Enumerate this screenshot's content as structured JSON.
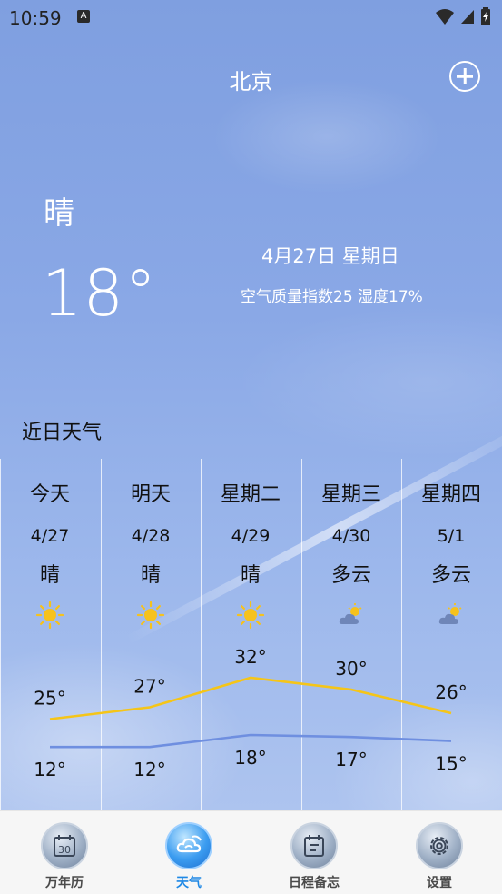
{
  "status_bar": {
    "time": "10:59",
    "notification_badge": "A",
    "icons": [
      "wifi-icon",
      "signal-icon",
      "battery-charging-icon"
    ]
  },
  "header": {
    "city": "北京",
    "add_icon": "add-city-icon"
  },
  "current": {
    "condition": "晴",
    "temperature": "18°",
    "date": "4月27日 星期日",
    "air_humidity": "空气质量指数25 湿度17%"
  },
  "forecast": {
    "title": "近日天气",
    "days": [
      {
        "name": "今天",
        "date": "4/27",
        "condition": "晴",
        "icon": "sun-icon",
        "high": 25,
        "low": 12
      },
      {
        "name": "明天",
        "date": "4/28",
        "condition": "晴",
        "icon": "sun-icon",
        "high": 27,
        "low": 12
      },
      {
        "name": "星期二",
        "date": "4/29",
        "condition": "晴",
        "icon": "sun-icon",
        "high": 32,
        "low": 18
      },
      {
        "name": "星期三",
        "date": "4/30",
        "condition": "多云",
        "icon": "cloud-sun-icon",
        "high": 30,
        "low": 17
      },
      {
        "name": "星期四",
        "date": "5/1",
        "condition": "多云",
        "icon": "cloud-sun-icon",
        "high": 26,
        "low": 15
      }
    ],
    "high_label_suffix": "°",
    "low_label_suffix": "°",
    "high_color": "#f5c518",
    "low_color": "#6f8fe0"
  },
  "bottom_nav": {
    "items": [
      {
        "label": "万年历",
        "icon": "calendar-icon",
        "active": false
      },
      {
        "label": "天气",
        "icon": "weather-icon",
        "active": true
      },
      {
        "label": "日程备忘",
        "icon": "schedule-icon",
        "active": false
      },
      {
        "label": "设置",
        "icon": "settings-icon",
        "active": false
      }
    ],
    "active_color": "#1e88e5"
  }
}
